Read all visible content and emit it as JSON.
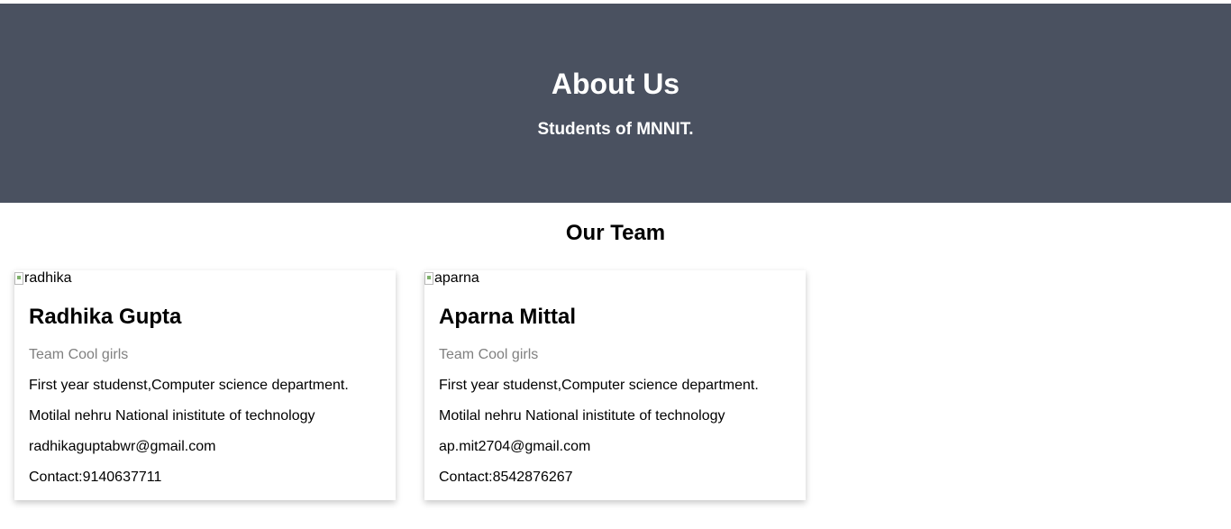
{
  "hero": {
    "title": "About Us",
    "subtitle": "Students of MNNIT."
  },
  "team_section": {
    "title": "Our Team"
  },
  "members": [
    {
      "image_alt": "radhika",
      "name": "Radhika Gupta",
      "team": "Team Cool girls",
      "description": "First year studenst,Computer science department.",
      "institute": "Motilal nehru National inistitute of technology",
      "email": "radhikaguptabwr@gmail.com",
      "contact": "Contact:9140637711"
    },
    {
      "image_alt": "aparna",
      "name": "Aparna Mittal",
      "team": "Team Cool girls",
      "description": "First year studenst,Computer science department.",
      "institute": "Motilal nehru National inistitute of technology",
      "email": "ap.mit2704@gmail.com",
      "contact": "Contact:8542876267"
    }
  ],
  "colors": {
    "hero_background": "#4a5160",
    "hero_text": "#ffffff",
    "team_text": "#808080"
  }
}
